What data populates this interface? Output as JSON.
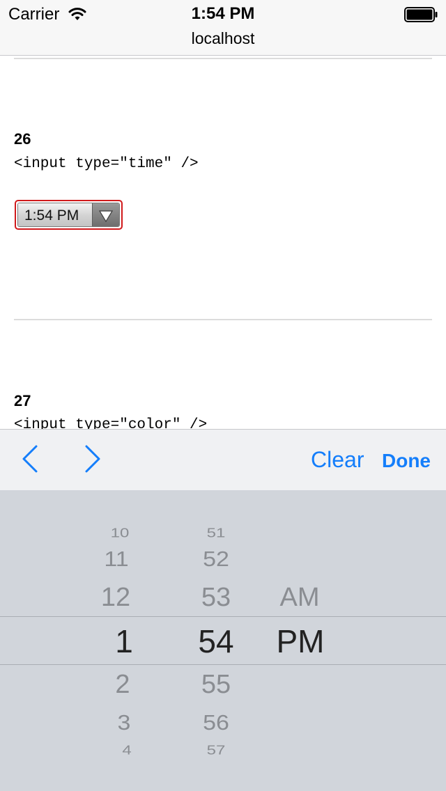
{
  "status_bar": {
    "carrier": "Carrier",
    "time": "1:54 PM",
    "icons": [
      "wifi-icon",
      "battery-icon"
    ]
  },
  "browser": {
    "url": "localhost"
  },
  "page": {
    "section_26": {
      "number": "26",
      "code": "<input type=\"time\" />",
      "input_value": "1:54 PM"
    },
    "section_27": {
      "number": "27",
      "code": "<input type=\"color\" />"
    }
  },
  "accessory_bar": {
    "prev_icon": "chevron-left-icon",
    "next_icon": "chevron-right-icon",
    "clear_label": "Clear",
    "done_label": "Done",
    "accent_color": "#147efb"
  },
  "picker": {
    "hours": [
      "10",
      "11",
      "12",
      "1",
      "2",
      "3",
      "4"
    ],
    "selected_hour": "1",
    "minutes": [
      "51",
      "52",
      "53",
      "54",
      "55",
      "56",
      "57"
    ],
    "selected_minute": "54",
    "periods": [
      "AM",
      "PM"
    ],
    "selected_period": "PM"
  }
}
